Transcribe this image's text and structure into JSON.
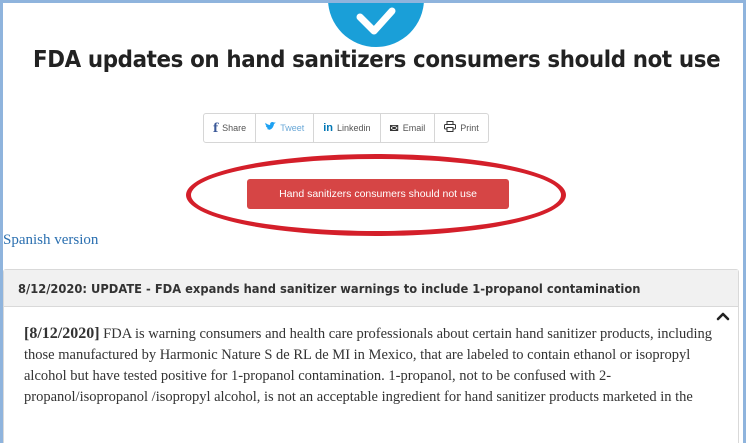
{
  "page_title": "FDA updates on hand sanitizers consumers should not use",
  "share": [
    {
      "icon": "facebook-icon",
      "glyph": "f",
      "label": "Share"
    },
    {
      "icon": "twitter-icon",
      "glyph": "🐦",
      "label": "Tweet"
    },
    {
      "icon": "linkedin-icon",
      "glyph": "in",
      "label": "Linkedin"
    },
    {
      "icon": "email-icon",
      "glyph": "✉",
      "label": "Email"
    },
    {
      "icon": "print-icon",
      "glyph": "🖶",
      "label": "Print"
    }
  ],
  "red_button_label": "Hand sanitizers consumers should not use",
  "spanish_link": "Spanish version",
  "panel": {
    "heading": "8/12/2020: UPDATE - FDA expands hand sanitizer warnings to include 1-propanol contamination",
    "date": "[8/12/2020]",
    "body": " FDA is warning consumers and health care professionals about certain hand sanitizer products, including those manufactured by Harmonic Nature S de RL de MI in Mexico, that are labeled to contain ethanol or isopropyl alcohol but have tested positive for 1-propanol contamination. 1-propanol, not to be confused with 2-propanol/isopropanol /isopropyl alcohol, is not an acceptable ingredient for hand sanitizer products marketed in the"
  },
  "colors": {
    "badge": "#1a9fd8",
    "red_button": "#d64545",
    "highlight_ellipse": "#d41f2a",
    "link": "#2a6fb0"
  }
}
